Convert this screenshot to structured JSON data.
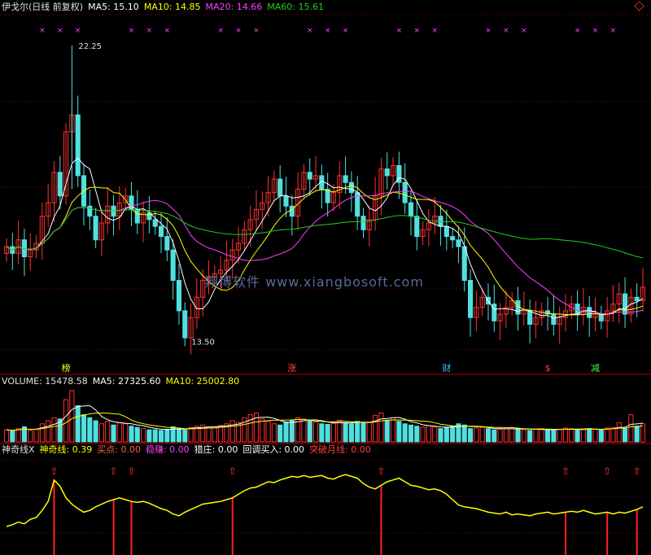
{
  "chart_data": {
    "type": "candlestick",
    "title": "伊戈尔(日线 前复权)",
    "main_indicators": [
      {
        "name": "MA5",
        "label": "MA5: 15.10",
        "color": "#ffffff"
      },
      {
        "name": "MA10",
        "label": "MA10: 14.85",
        "color": "#ffff00"
      },
      {
        "name": "MA20",
        "label": "MA20: 14.66",
        "color": "#ff40ff"
      },
      {
        "name": "MA60",
        "label": "MA60: 15.61",
        "color": "#20d020"
      }
    ],
    "price_range": [
      13,
      23
    ],
    "high_marker": "22.25",
    "low_marker": "13.50",
    "event_tags": [
      {
        "text": "榜",
        "color": "#ffff00",
        "idx": 10
      },
      {
        "text": "涨",
        "color": "#ff4040",
        "idx": 48
      },
      {
        "text": "财",
        "color": "#40c0ff",
        "idx": 74
      },
      {
        "text": "$",
        "color": "#ff4040",
        "idx": 91
      },
      {
        "text": "减",
        "color": "#40ff40",
        "idx": 99
      }
    ],
    "volume_panel": {
      "label": "VOLUME: 15478.58",
      "ma5": "MA5: 27325.60",
      "ma10": "MA10: 25002.80"
    },
    "indicator_panel": {
      "name": "神奇线X",
      "values": [
        {
          "label": "神奇线: 0.39",
          "color": "#ffff00"
        },
        {
          "label": "买点: 0.00",
          "color": "#ff6040"
        },
        {
          "label": "稳赚: 0.00",
          "color": "#ff40ff"
        },
        {
          "label": "猎庄: 0.00",
          "color": "#ffffff"
        },
        {
          "label": "回调买入: 0.00",
          "color": "#ffffff"
        },
        {
          "label": "突破月线: 0.00",
          "color": "#ff4040"
        }
      ],
      "signal_indices": [
        8,
        18,
        21,
        38,
        63,
        94,
        101,
        106
      ]
    },
    "closes": [
      16.3,
      16.1,
      16.5,
      16.0,
      16.2,
      16.4,
      17.2,
      17.6,
      18.5,
      17.8,
      19.7,
      20.2,
      18.4,
      17.5,
      17.2,
      16.5,
      17.0,
      17.5,
      17.2,
      17.6,
      17.8,
      17.4,
      17.0,
      17.3,
      17.1,
      16.9,
      16.6,
      16.2,
      15.3,
      14.4,
      13.6,
      14.2,
      14.8,
      15.3,
      15.4,
      15.5,
      15.6,
      15.9,
      16.2,
      16.4,
      16.8,
      17.1,
      17.4,
      17.6,
      17.9,
      18.3,
      17.8,
      17.5,
      17.2,
      18.0,
      18.5,
      18.3,
      18.4,
      18.0,
      17.6,
      17.9,
      18.4,
      18.2,
      17.9,
      17.2,
      16.8,
      17.1,
      17.8,
      18.6,
      18.4,
      18.7,
      18.2,
      17.6,
      17.2,
      16.6,
      16.8,
      17.0,
      17.2,
      16.9,
      16.6,
      16.5,
      16.3,
      15.3,
      14.2,
      14.5,
      14.8,
      14.6,
      14.1,
      14.3,
      14.5,
      14.7,
      14.3,
      14.4,
      14.0,
      14.2,
      14.4,
      14.3,
      14.0,
      14.2,
      14.4,
      14.6,
      14.3,
      14.5,
      14.2,
      14.3,
      14.1,
      14.4,
      14.6,
      14.9,
      14.3,
      14.8,
      14.7,
      15.1
    ],
    "volumes": [
      20,
      18,
      22,
      25,
      19,
      21,
      30,
      35,
      40,
      38,
      70,
      85,
      60,
      45,
      40,
      35,
      30,
      34,
      28,
      32,
      30,
      26,
      24,
      22,
      20,
      20,
      19,
      21,
      25,
      22,
      20,
      24,
      26,
      28,
      25,
      23,
      27,
      30,
      35,
      32,
      40,
      45,
      48,
      38,
      34,
      30,
      28,
      33,
      36,
      40,
      38,
      35,
      33,
      30,
      29,
      31,
      36,
      32,
      30,
      34,
      32,
      33,
      44,
      48,
      36,
      40,
      34,
      30,
      28,
      26,
      24,
      27,
      25,
      22,
      24,
      26,
      30,
      28,
      22,
      23,
      24,
      22,
      20,
      21,
      22,
      24,
      21,
      20,
      19,
      21,
      22,
      20,
      19,
      21,
      23,
      22,
      21,
      20,
      22,
      21,
      20,
      23,
      24,
      32,
      22,
      45,
      26,
      30
    ],
    "line_values": [
      0.3,
      0.32,
      0.35,
      0.33,
      0.38,
      0.4,
      0.48,
      0.58,
      0.82,
      0.75,
      0.62,
      0.55,
      0.5,
      0.46,
      0.48,
      0.52,
      0.55,
      0.58,
      0.6,
      0.62,
      0.6,
      0.58,
      0.57,
      0.58,
      0.56,
      0.53,
      0.5,
      0.48,
      0.44,
      0.42,
      0.46,
      0.49,
      0.52,
      0.55,
      0.56,
      0.57,
      0.58,
      0.6,
      0.62,
      0.66,
      0.7,
      0.73,
      0.74,
      0.77,
      0.8,
      0.79,
      0.82,
      0.84,
      0.86,
      0.85,
      0.87,
      0.85,
      0.86,
      0.87,
      0.84,
      0.83,
      0.86,
      0.88,
      0.86,
      0.84,
      0.78,
      0.74,
      0.72,
      0.76,
      0.8,
      0.82,
      0.84,
      0.8,
      0.76,
      0.75,
      0.73,
      0.71,
      0.72,
      0.7,
      0.66,
      0.6,
      0.54,
      0.52,
      0.51,
      0.5,
      0.48,
      0.46,
      0.45,
      0.44,
      0.46,
      0.43,
      0.44,
      0.43,
      0.42,
      0.44,
      0.45,
      0.46,
      0.44,
      0.45,
      0.46,
      0.47,
      0.46,
      0.48,
      0.46,
      0.44,
      0.45,
      0.46,
      0.44,
      0.46,
      0.45,
      0.47,
      0.49,
      0.52
    ]
  },
  "watermark": "翔博软件 www.xiangbosoft.com"
}
